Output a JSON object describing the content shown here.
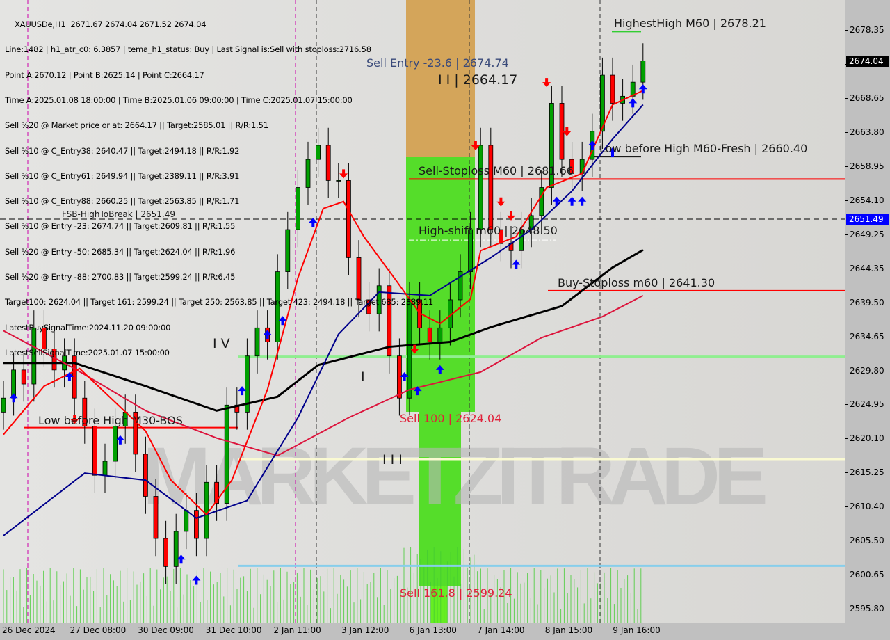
{
  "chart_data": {
    "type": "candlestick",
    "symbol_header": "XAUUSDe,H1  2671.67 2674.04 2671.52 2674.04",
    "ylim": [
      2594.5,
      2682.5
    ],
    "y_ticks": [
      "2678.35",
      "2673.50",
      "2668.65",
      "2663.80",
      "2658.95",
      "2654.10",
      "2649.25",
      "2644.35",
      "2639.50",
      "2634.65",
      "2629.80",
      "2624.95",
      "2620.10",
      "2615.25",
      "2610.40",
      "2605.50",
      "2600.65",
      "2595.80"
    ],
    "x_ticks": [
      {
        "bar": 0,
        "label": "26 Dec 2024"
      },
      {
        "bar": 8,
        "label": "27 Dec 08:00"
      },
      {
        "bar": 16,
        "label": "30 Dec 09:00"
      },
      {
        "bar": 24,
        "label": "31 Dec 10:00"
      },
      {
        "bar": 32,
        "label": "2 Jan 11:00"
      },
      {
        "bar": 40,
        "label": "3 Jan 12:00"
      },
      {
        "bar": 48,
        "label": "6 Jan 13:00"
      },
      {
        "bar": 56,
        "label": "7 Jan 14:00"
      },
      {
        "bar": 64,
        "label": "8 Jan 15:00"
      },
      {
        "bar": 72,
        "label": "9 Jan 16:00"
      }
    ],
    "closes": [
      2626,
      2630,
      2628,
      2636,
      2633,
      2630,
      2632,
      2626,
      2622,
      2615,
      2617,
      2622,
      2624,
      2618,
      2612,
      2606,
      2602,
      2607,
      2610,
      2606,
      2614,
      2611,
      2625,
      2624,
      2632,
      2636,
      2634,
      2644,
      2650,
      2656,
      2660,
      2662,
      2657,
      2657,
      2646,
      2640,
      2638,
      2642,
      2632,
      2626,
      2640,
      2636,
      2634,
      2636,
      2640,
      2644,
      2650,
      2662,
      2650,
      2648,
      2647,
      2650,
      2652,
      2656,
      2668,
      2660,
      2658,
      2660,
      2664,
      2672,
      2668,
      2669,
      2671,
      2674.04
    ],
    "moving_averages": [
      {
        "color": "#000000",
        "points": [
          [
            0,
            2631
          ],
          [
            7,
            2631
          ],
          [
            14,
            2627.7
          ],
          [
            21,
            2624.2
          ],
          [
            27,
            2626.2
          ],
          [
            31,
            2630.7
          ],
          [
            38,
            2633.3
          ],
          [
            44,
            2634
          ],
          [
            48,
            2636.1
          ],
          [
            55,
            2639.1
          ],
          [
            60,
            2644.6
          ],
          [
            63,
            2647.1
          ]
        ]
      },
      {
        "color": "#dc143c",
        "points": [
          [
            0,
            2635.6
          ],
          [
            7,
            2630.2
          ],
          [
            14,
            2624.2
          ],
          [
            21,
            2620.3
          ],
          [
            27,
            2617.8
          ],
          [
            34,
            2623.2
          ],
          [
            40,
            2627.2
          ],
          [
            47,
            2629.7
          ],
          [
            53,
            2634.6
          ],
          [
            59,
            2637.6
          ],
          [
            63,
            2640.6
          ]
        ]
      },
      {
        "color": "#00008b",
        "points": [
          [
            0,
            2606.4
          ],
          [
            8,
            2615.3
          ],
          [
            14,
            2614.3
          ],
          [
            19,
            2608.9
          ],
          [
            24,
            2611.4
          ],
          [
            29,
            2623.2
          ],
          [
            33,
            2635.1
          ],
          [
            37,
            2641.1
          ],
          [
            42,
            2640.6
          ],
          [
            48,
            2646
          ],
          [
            52,
            2650
          ],
          [
            56,
            2655.5
          ],
          [
            60,
            2662.9
          ],
          [
            63,
            2667.8
          ]
        ]
      },
      {
        "color": "#ff0000",
        "points": [
          [
            0,
            2620.8
          ],
          [
            4,
            2627.7
          ],
          [
            7.5,
            2630.2
          ],
          [
            14,
            2621.3
          ],
          [
            16.5,
            2614.3
          ],
          [
            20,
            2609.4
          ],
          [
            22.5,
            2614.3
          ],
          [
            26,
            2627.2
          ],
          [
            29,
            2643.1
          ],
          [
            31.5,
            2653
          ],
          [
            33.5,
            2654
          ],
          [
            35.5,
            2649
          ],
          [
            38.5,
            2643.1
          ],
          [
            41,
            2638.1
          ],
          [
            43,
            2636.6
          ],
          [
            46,
            2640.1
          ],
          [
            47,
            2647
          ],
          [
            50.5,
            2649
          ],
          [
            53.5,
            2656
          ],
          [
            57,
            2658
          ],
          [
            60,
            2667.8
          ],
          [
            63,
            2669.8
          ]
        ]
      }
    ],
    "levels": [
      {
        "label": "FSB-HighToBreak | 2651.49",
        "price": 2651.49,
        "color": "#000000",
        "style": "dashed"
      },
      {
        "label": "Sell-Stoploss M60 | 2681.66",
        "price": 2657.2,
        "color": "#ff0000",
        "style": "solid"
      },
      {
        "label": "Buy-Stoploss m60 | 2641.30",
        "price": 2641.3,
        "color": "#ff0000",
        "style": "solid"
      },
      {
        "label": "Low before High  M60-Fresh | 2660.40",
        "price": 2660.4,
        "color": "#000000",
        "style": "solid"
      },
      {
        "label": "HighestHigh   M60 | 2678.21",
        "price": 2678.21,
        "color": "#32cd32",
        "style": "solid"
      },
      {
        "label": "High-shift m60 | 2648.50",
        "price": 2648.5,
        "color": "#ffffff",
        "style": "dashdot"
      },
      {
        "label": "Low before High  M30-BOS",
        "price": 2621.8,
        "color": "#ff0000",
        "style": "solid"
      },
      {
        "label": "",
        "price": 2631.9,
        "color": "#90ee90",
        "style": "solid"
      },
      {
        "label": "",
        "price": 2617.3,
        "color": "#fafad2",
        "style": "solid"
      },
      {
        "label": "",
        "price": 2602.1,
        "color": "#87ceeb",
        "style": "solid"
      }
    ],
    "sell_entry_label": "Sell Entry -23.6 | 2674.74",
    "sell_100_label": "Sell 100 | 2624.04",
    "sell_161_label": "Sell 161.8 | 2599.24",
    "wave_labels": {
      "w1": "I",
      "w2": "I I | 2664.17",
      "w3": "I I I",
      "w4": "I V"
    },
    "current_price": "2674.04",
    "fsb_price_tag": "2651.49",
    "signals": [
      [
        1,
        2626,
        "buy"
      ],
      [
        6.5,
        2629,
        "buy"
      ],
      [
        7,
        2623,
        "sell"
      ],
      [
        11.5,
        2620,
        "buy"
      ],
      [
        17.5,
        2603,
        "buy"
      ],
      [
        19,
        2600,
        "buy"
      ],
      [
        23.5,
        2627,
        "buy"
      ],
      [
        26,
        2635,
        "buy"
      ],
      [
        27.5,
        2637,
        "buy"
      ],
      [
        30.5,
        2651,
        "buy"
      ],
      [
        33.5,
        2658,
        "sell"
      ],
      [
        39.5,
        2629,
        "buy"
      ],
      [
        40.5,
        2633,
        "sell"
      ],
      [
        40.8,
        2627,
        "buy"
      ],
      [
        43,
        2630,
        "buy"
      ],
      [
        46.5,
        2662,
        "sell"
      ],
      [
        49,
        2654,
        "sell"
      ],
      [
        50,
        2652,
        "sell"
      ],
      [
        50.5,
        2645,
        "buy"
      ],
      [
        53.5,
        2671,
        "sell"
      ],
      [
        54.5,
        2654,
        "buy"
      ],
      [
        55.5,
        2664,
        "sell"
      ],
      [
        56,
        2654,
        "buy"
      ],
      [
        57,
        2654,
        "buy"
      ],
      [
        58,
        2662,
        "buy"
      ],
      [
        60,
        2661,
        "buy"
      ],
      [
        62,
        2668,
        "buy"
      ],
      [
        63,
        2670,
        "buy"
      ]
    ],
    "colors": {
      "bull": "#00a000",
      "bear": "#ff0000",
      "buy_arrow": "#0000ff",
      "sell_arrow": "#ff0000",
      "zone_orange": "#d4a55a",
      "zone_green": "#55dd2a"
    }
  },
  "info_lines": [
    "XAUUSDe,H1  2671.67 2674.04 2671.52 2674.04",
    "Line:1482 | h1_atr_c0: 6.3857 | tema_h1_status: Buy | Last Signal is:Sell with stoploss:2716.58",
    "Point A:2670.12 | Point B:2625.14 | Point C:2664.17",
    "Time A:2025.01.08 18:00:00 | Time B:2025.01.06 09:00:00 | Time C:2025.01.07 15:00:00",
    "Sell %20 @ Market price or at: 2664.17 || Target:2585.01 || R/R:1.51",
    "Sell %10 @ C_Entry38: 2640.47 || Target:2494.18 || R/R:1.92",
    "Sell %10 @ C_Entry61: 2649.94 || Target:2389.11 || R/R:3.91",
    "Sell %10 @ C_Entry88: 2660.25 || Target:2563.85 || R/R:1.71",
    "Sell %10 @ Entry -23: 2674.74 || Target:2609.81 || R/R:1.55",
    "Sell %20 @ Entry -50: 2685.34 || Target:2624.04 || R/R:1.96",
    "Sell %20 @ Entry -88: 2700.83 || Target:2599.24 || R/R:6.45",
    "Target100: 2624.04 || Target 161: 2599.24 || Target 250: 2563.85 || Target 423: 2494.18 || Target 685: 2389.11",
    "LatestBuySignalTime:2024.11.20 09:00:00",
    "LatestSellSignalTime:2025.01.07 15:00:00"
  ],
  "watermark": "MARKETZITRADE"
}
